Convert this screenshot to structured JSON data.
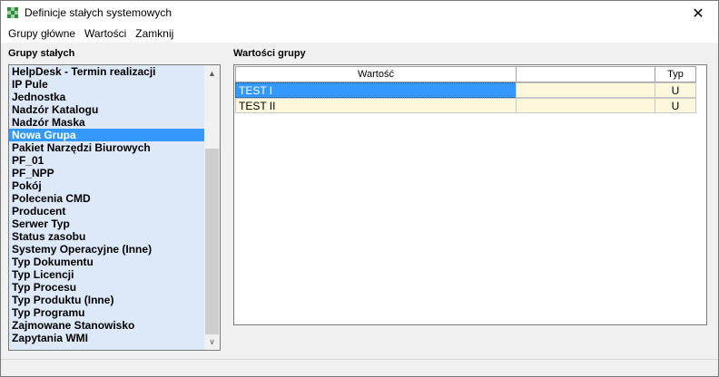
{
  "window": {
    "title": "Definicje stałych systemowych",
    "close_label": "✕"
  },
  "menu": [
    "Grupy główne",
    "Wartości",
    "Zamknij"
  ],
  "left_panel": {
    "label": "Grupy stałych",
    "selected_index": 6,
    "items": [
      "HelpDesk - Termin realizacji",
      "IP Pule",
      "Jednostka",
      "Nadzór Katalogu",
      "Nadzór Maska",
      "Nowa Grupa",
      "Pakiet Narzędzi Biurowych",
      "PF_01",
      "PF_NPP",
      "Pokój",
      "Polecenia CMD",
      "Producent",
      "Serwer Typ",
      "Status zasobu",
      "Systemy Operacyjne (Inne)",
      "Typ Dokumentu",
      "Typ Licencji",
      "Typ Procesu",
      "Typ Produktu (Inne)",
      "Typ Programu",
      "Zajmowane Stanowisko",
      "Zapytania WMI"
    ],
    "scroll_up_icon": "▲",
    "scroll_down_icon": "∨"
  },
  "right_panel": {
    "label": "Wartości grupy",
    "columns": [
      "Wartość",
      "",
      "Typ"
    ],
    "rows": [
      [
        "TEST I",
        "",
        "U"
      ],
      [
        "TEST II",
        "",
        "U"
      ]
    ]
  },
  "colors": {
    "list_background": "#dde8f8",
    "selection": "#3399ff",
    "row_background": "#fdf8dc"
  },
  "icons": {
    "app_icon": "checkerboard-icon",
    "close_icon": "close-icon"
  }
}
